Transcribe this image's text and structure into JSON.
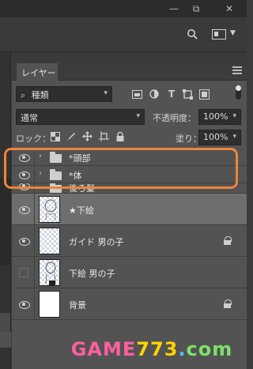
{
  "window": {
    "minimize_glyph": "—",
    "restore_glyph": "⧉",
    "close_glyph": "✕"
  },
  "toolbar": {
    "search_icon": "search-icon",
    "workspace_icon": "panel-icon"
  },
  "panel": {
    "tab_label": "レイヤー",
    "filter": {
      "kind_label": "種類",
      "search_glyph": "⌕"
    },
    "blend_mode": "通常",
    "opacity_label": "不透明度：",
    "opacity_value": "100%",
    "lock_label": "ロック：",
    "fill_label": "塗り：",
    "fill_value": "100%"
  },
  "layers": [
    {
      "name": "*頭部",
      "type": "group",
      "visible": true
    },
    {
      "name": "*体",
      "type": "group",
      "visible": true
    },
    {
      "name": "後ろ髪",
      "type": "group",
      "visible": true
    },
    {
      "name": "★下絵",
      "type": "layer",
      "visible": true,
      "selected": true
    },
    {
      "name": "ガイド 男の子",
      "type": "layer",
      "visible": true,
      "locked": true
    },
    {
      "name": "下絵 男の子",
      "type": "layer",
      "visible": false
    },
    {
      "name": "背景",
      "type": "layer",
      "visible": true,
      "locked": true
    }
  ],
  "watermark": {
    "part1": "GAME",
    "part2": "773",
    "part3": ".",
    "part4": "com"
  },
  "colors": {
    "highlight": "#f0843a",
    "selected_row": "#6e6e6e",
    "panel_bg": "#535353"
  }
}
